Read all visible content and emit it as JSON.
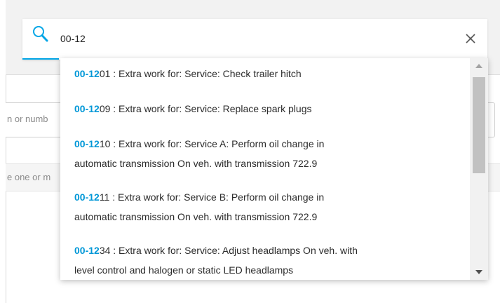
{
  "background": {
    "field_1_placeholder_fragment": "n or numb",
    "field_2_placeholder_fragment": "e one or m"
  },
  "search": {
    "value": "00-12",
    "icon": "search-icon",
    "clear_icon": "close-icon",
    "accent_color": "#00a5e6"
  },
  "results": [
    {
      "match": "00-12",
      "rest_line1": "01 : Extra work for: Service: Check trailer hitch",
      "rest_line2": ""
    },
    {
      "match": "00-12",
      "rest_line1": "09 : Extra work for: Service: Replace spark plugs",
      "rest_line2": ""
    },
    {
      "match": "00-12",
      "rest_line1": "10 : Extra work for: Service A: Perform oil change in",
      "rest_line2": "automatic transmission On veh. with transmission 722.9"
    },
    {
      "match": "00-12",
      "rest_line1": "11 : Extra work for: Service B: Perform oil change in",
      "rest_line2": "automatic transmission On veh. with transmission 722.9"
    },
    {
      "match": "00-12",
      "rest_line1": "34 : Extra work for: Service: Adjust headlamps On veh. with",
      "rest_line2": "level control and halogen or static LED headlamps"
    }
  ],
  "highlight_color": "#0097d7"
}
